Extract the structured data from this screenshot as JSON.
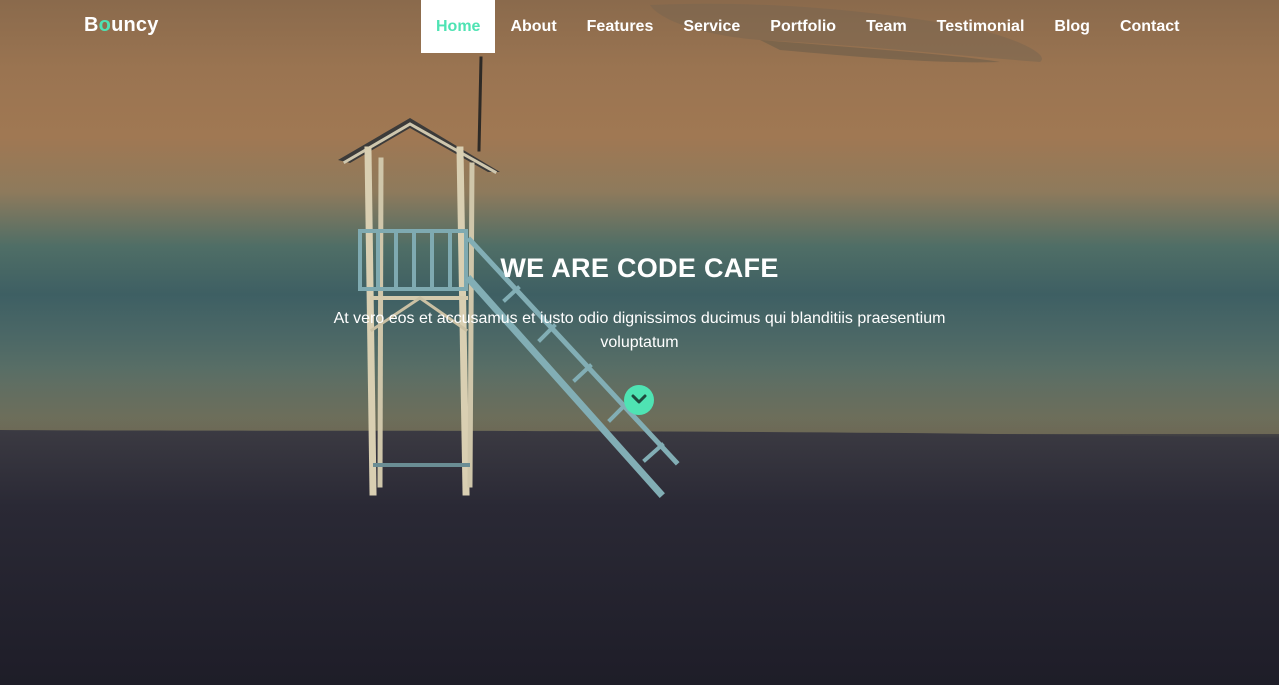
{
  "brand": {
    "first_letter": "B",
    "accent_letter": "o",
    "rest": "uncy"
  },
  "nav": {
    "items": [
      {
        "label": "Home",
        "active": true
      },
      {
        "label": "About"
      },
      {
        "label": "Features"
      },
      {
        "label": "Service"
      },
      {
        "label": "Portfolio"
      },
      {
        "label": "Team"
      },
      {
        "label": "Testimonial"
      },
      {
        "label": "Blog"
      },
      {
        "label": "Contact"
      }
    ]
  },
  "hero": {
    "title": "WE ARE CODE CAFE",
    "subtitle": "At vero eos et accusamus et iusto odio dignissimos ducimus qui blanditiis praesentium voluptatum",
    "scroll_icon": "chevron-down-icon"
  },
  "colors": {
    "accent": "#4fe3b3",
    "text": "#ffffff"
  }
}
